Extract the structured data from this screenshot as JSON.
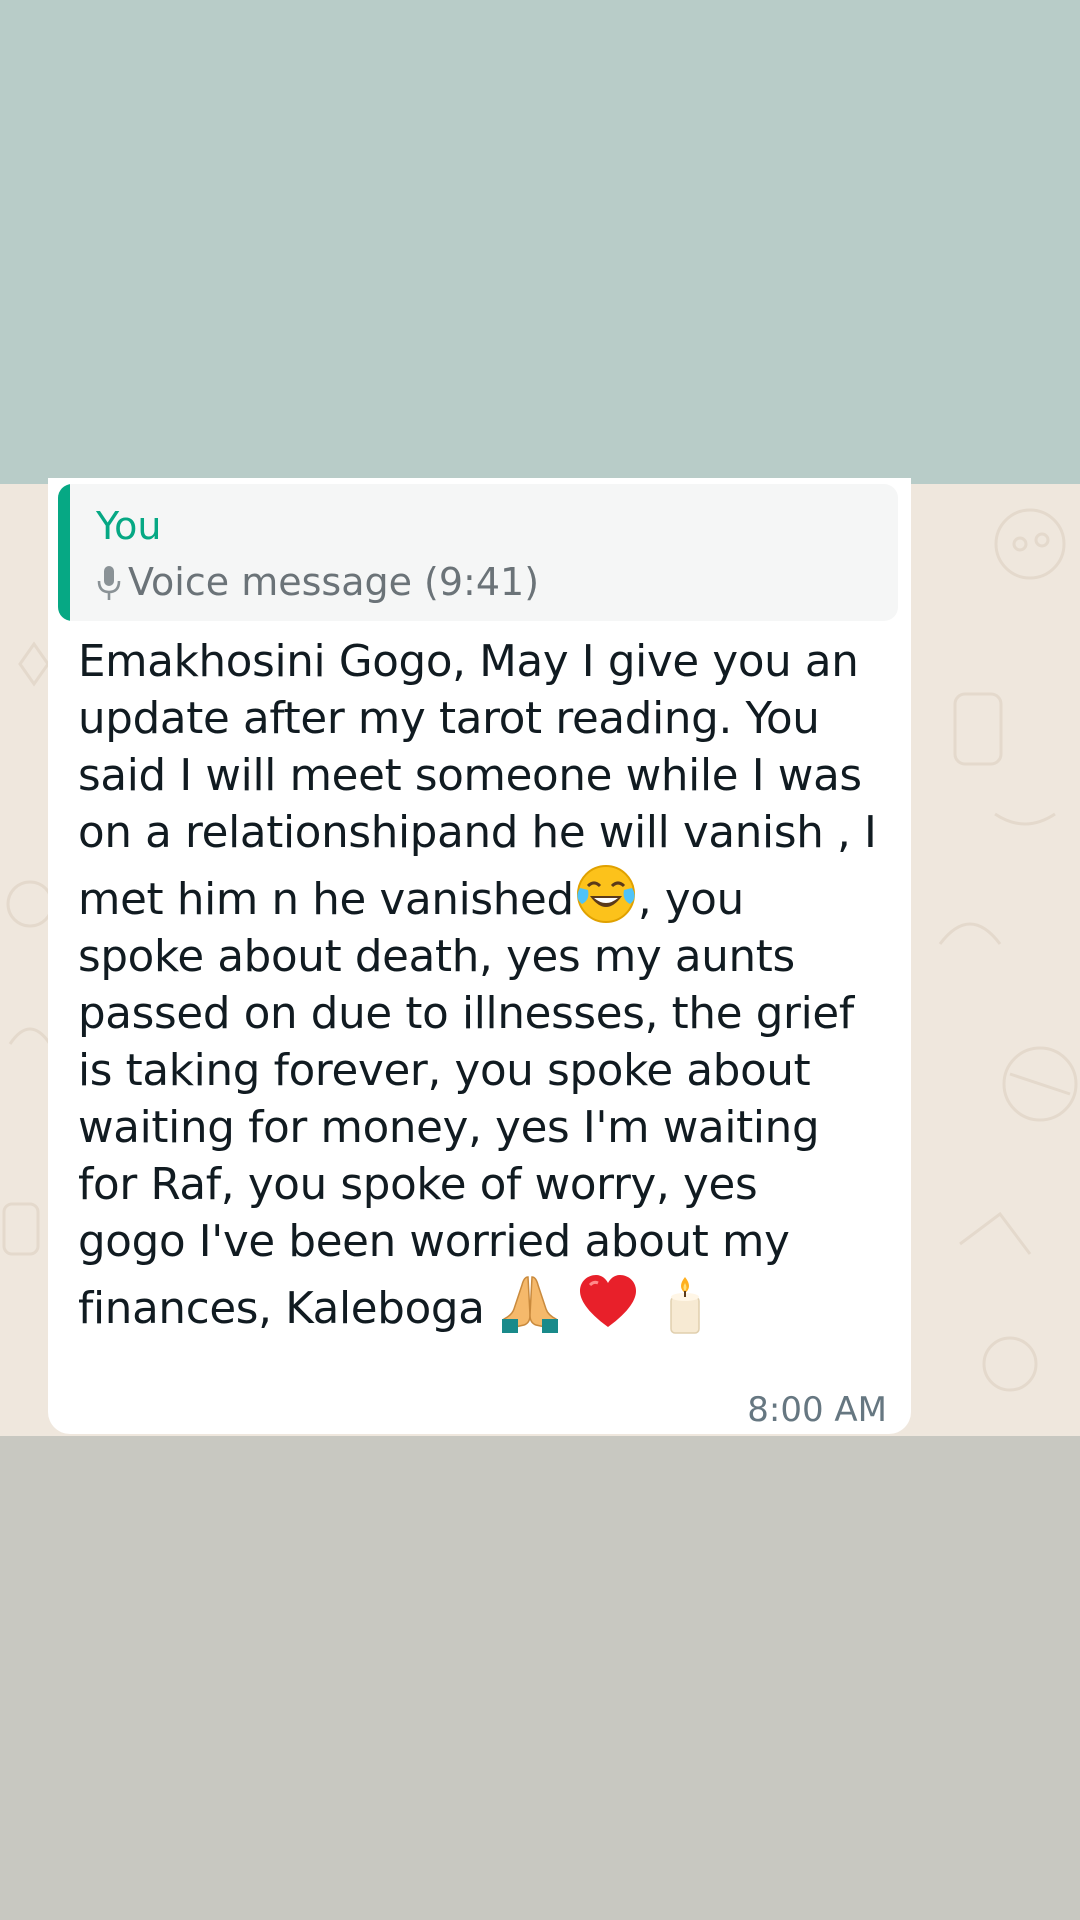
{
  "reply_quote": {
    "author": "You",
    "icon": "microphone-icon",
    "label": "Voice message (9:41)"
  },
  "message": {
    "lines": [
      "Emakhosini Gogo, May I give you an",
      "update after my tarot reading. You",
      "said I will meet someone while I was",
      "on a relationshipand he will vanish , I",
      "met him n he vanished",
      ", you",
      "spoke about death, yes my aunts",
      "passed on due to illnesses, the grief",
      "is taking forever, you spoke about",
      "waiting for money, yes I'm waiting",
      "for Raf, you spoke of worry, yes",
      "gogo I've been worried about my",
      "finances, Kaleboga "
    ],
    "emojis": [
      "face-with-tears-of-joy-icon",
      "folded-hands-icon",
      "red-heart-icon",
      "candle-icon"
    ],
    "time": "8:00 AM"
  },
  "colors": {
    "top_band": "#b8ccc8",
    "chat_background": "#efe7dd",
    "bottom_band": "#c8c8c1",
    "accent": "#06a884"
  }
}
